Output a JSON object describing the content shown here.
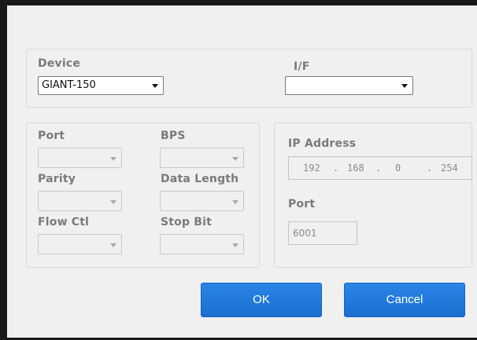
{
  "device": {
    "label": "Device",
    "selected": "GIANT-150"
  },
  "interface": {
    "label": "I/F",
    "selected": ""
  },
  "serial": {
    "port_label": "Port",
    "bps_label": "BPS",
    "parity_label": "Parity",
    "data_length_label": "Data Length",
    "flow_ctl_label": "Flow Ctl",
    "stop_bit_label": "Stop Bit"
  },
  "network": {
    "ip_label": "IP Address",
    "ip": [
      "192",
      "168",
      "0",
      "254"
    ],
    "ip_dot": ".",
    "port_label": "Port",
    "port_value": "6001"
  },
  "buttons": {
    "ok": "OK",
    "cancel": "Cancel"
  }
}
